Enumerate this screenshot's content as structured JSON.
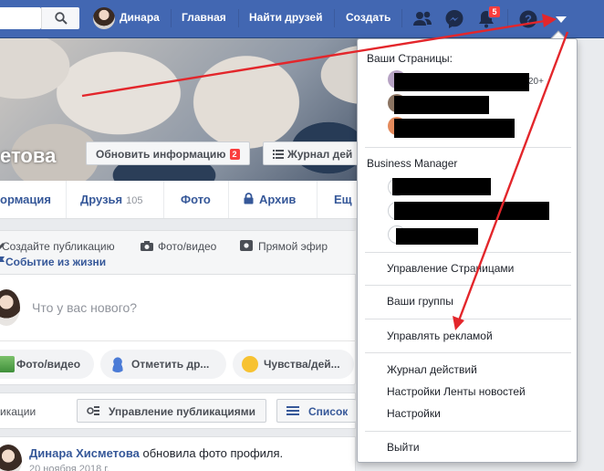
{
  "topbar": {
    "user_name": "Динара",
    "nav": [
      "Главная",
      "Найти друзей",
      "Создать"
    ],
    "notifications_count": "5",
    "icons": [
      "search-icon",
      "friends-icon",
      "messenger-icon",
      "bell-icon",
      "help-icon",
      "caret-down-icon"
    ]
  },
  "profile": {
    "name_fragment": "етова",
    "update_button": "Обновить информацию",
    "update_count": "2",
    "activity_log_button": "Журнал дей"
  },
  "tabs": [
    {
      "label": "ормация"
    },
    {
      "label": "Друзья",
      "count": "105"
    },
    {
      "label": "Фото"
    },
    {
      "label": "Архив"
    },
    {
      "label": "Ещ"
    }
  ],
  "composer": {
    "create_post": "Создайте публикацию",
    "photo_video": "Фото/видео",
    "live": "Прямой эфир",
    "life_event": "Событие из жизни",
    "placeholder": "Что у вас нового?",
    "pills": [
      "Фото/видео",
      "Отметить др...",
      "Чувства/дей..."
    ]
  },
  "posts": {
    "label": "икации",
    "manage_button": "Управление публикациями",
    "list_button": "Список"
  },
  "post": {
    "author": "Динара Хисметова",
    "action": "обновила фото профиля.",
    "date": "20 ноября 2018 г."
  },
  "dropdown": {
    "pages_header": "Ваши Страницы:",
    "pages_more": "20+",
    "business_header": "Business Manager",
    "items_group1": [
      "Управление Страницами"
    ],
    "items_group2": [
      "Ваши группы"
    ],
    "items_group3": [
      "Управлять рекламой"
    ],
    "items_group4": [
      "Журнал действий",
      "Настройки Ленты новостей",
      "Настройки"
    ],
    "items_group5": [
      "Выйти"
    ]
  },
  "colors": {
    "topbar": "#4267b2",
    "link": "#365899",
    "annotation": "#e3262b"
  }
}
